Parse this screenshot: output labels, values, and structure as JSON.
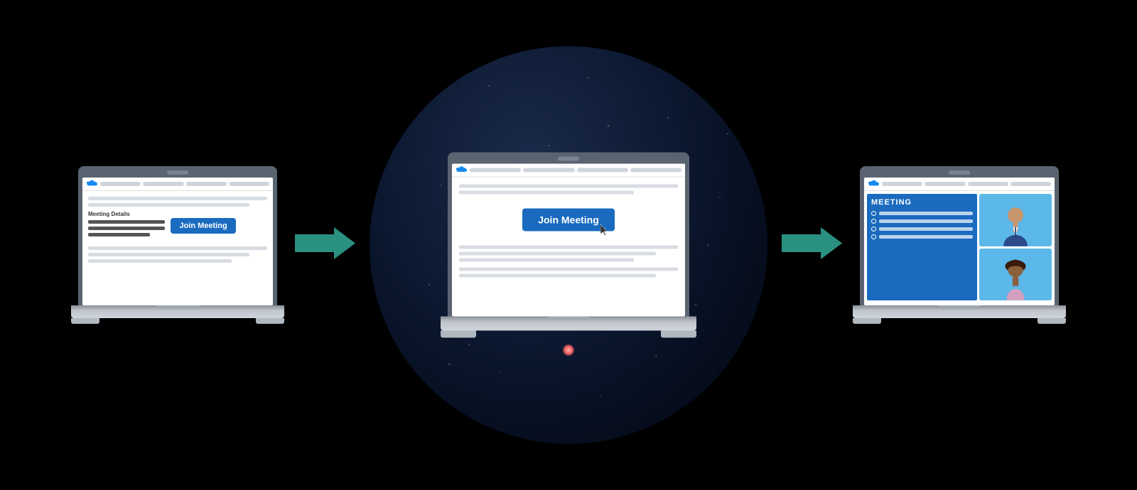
{
  "scene": {
    "background_color": "#000000",
    "circle": {
      "description": "Dark starry night sky circle",
      "color_center": "#1a2a4a",
      "color_edge": "#030812"
    }
  },
  "laptop_left": {
    "label": "laptop-left",
    "screen": {
      "topbar": {
        "salesforce_icon": "cloud",
        "nav_pills": 4
      },
      "content": {
        "meeting_details_label": "Meeting Details",
        "join_button_label": "Join Meeting"
      }
    }
  },
  "laptop_center": {
    "label": "laptop-center",
    "screen": {
      "topbar": {
        "salesforce_icon": "cloud",
        "nav_pills": 4
      },
      "content": {
        "join_button_label": "Join Meeting"
      }
    }
  },
  "laptop_right": {
    "label": "laptop-right",
    "screen": {
      "topbar": {
        "salesforce_icon": "cloud",
        "nav_pills": 4
      },
      "content": {
        "meeting_panel_title": "MEETING",
        "list_items": 4,
        "avatars": 2
      }
    }
  },
  "arrows": {
    "left_arrow_label": "→",
    "right_arrow_label": "→",
    "color": "#2a9080"
  }
}
